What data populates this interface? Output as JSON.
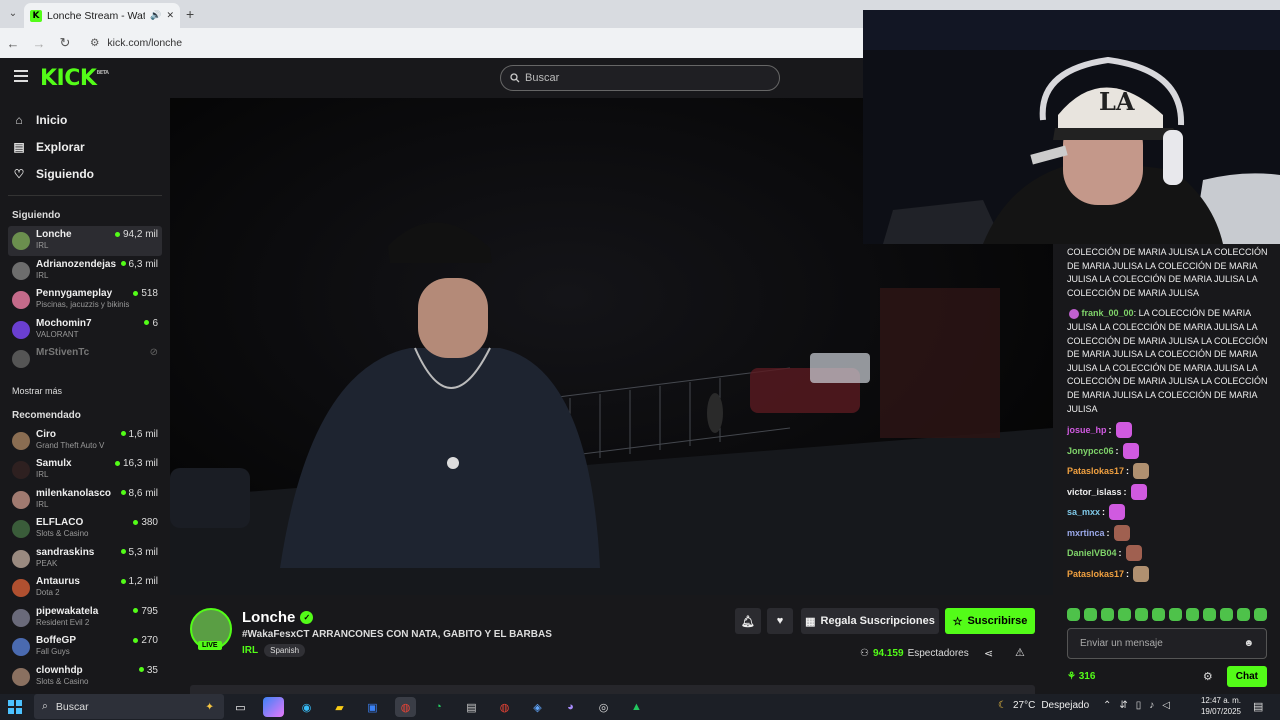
{
  "browser": {
    "tab_title": "Lonche Stream - Watch Live",
    "url": "kick.com/lonche"
  },
  "header": {
    "logo": "KICK",
    "logo_badge": "BETA",
    "search_placeholder": "Buscar"
  },
  "sidebar": {
    "nav": [
      {
        "label": "Inicio",
        "icon": "home-icon"
      },
      {
        "label": "Explorar",
        "icon": "compass-icon"
      },
      {
        "label": "Siguiendo",
        "icon": "heart-icon"
      }
    ],
    "following_title": "Siguiendo",
    "following": [
      {
        "name": "Lonche",
        "category": "IRL",
        "viewers": "94,2 mil",
        "color": "#6b8f4e"
      },
      {
        "name": "Adrianozendejas",
        "category": "IRL",
        "viewers": "6,3 mil",
        "color": "#6d6d6d"
      },
      {
        "name": "Pennygameplay",
        "category": "Piscinas, jacuzzis y bikinis",
        "viewers": "518",
        "color": "#c46a8a"
      },
      {
        "name": "Mochomin7",
        "category": "VALORANT",
        "viewers": "6",
        "color": "#6a3fd0"
      },
      {
        "name": "MrStivenTc",
        "category": "",
        "viewers": "",
        "color": "#555"
      }
    ],
    "show_more": "Mostrar más",
    "recommended_title": "Recomendado",
    "recommended": [
      {
        "name": "Ciro",
        "category": "Grand Theft Auto V",
        "viewers": "1,6 mil",
        "color": "#8a6d52"
      },
      {
        "name": "Samulx",
        "category": "IRL",
        "viewers": "16,3 mil",
        "color": "#2e2020"
      },
      {
        "name": "milenkanolasco",
        "category": "IRL",
        "viewers": "8,6 mil",
        "color": "#a07a70"
      },
      {
        "name": "ELFLACO",
        "category": "Slots & Casino",
        "viewers": "380",
        "color": "#3a5c3a"
      },
      {
        "name": "sandraskins",
        "category": "PEAK",
        "viewers": "5,3 mil",
        "color": "#9a8a80"
      },
      {
        "name": "Antaurus",
        "category": "Dota 2",
        "viewers": "1,2 mil",
        "color": "#b05030"
      },
      {
        "name": "pipewakatela",
        "category": "Resident Evil 2",
        "viewers": "795",
        "color": "#6a6a7a"
      },
      {
        "name": "BoffeGP",
        "category": "Fall Guys",
        "viewers": "270",
        "color": "#4a6ab0"
      },
      {
        "name": "clownhdp",
        "category": "Slots & Casino",
        "viewers": "35",
        "color": "#8a7060"
      }
    ]
  },
  "stream": {
    "name": "Lonche",
    "live_badge": "LIVE",
    "title": "#WakaFesxCT ARRANCONES CON NATA, GABITO Y EL BARBAS",
    "category": "IRL",
    "tag": "Spanish",
    "gift_label": "Regala Suscripciones",
    "subscribe_label": "Suscribirse",
    "viewers_count": "94.159",
    "viewers_label": "Espectadores"
  },
  "chat": {
    "top_message": "COLECCIÓN DE MARIA JULISA LA COLECCIÓN DE MARIA JULISA LA COLECCIÓN DE MARIA JULISA LA COLECCIÓN DE MARIA JULISA LA COLECCIÓN DE MARIA JULISA",
    "messages": [
      {
        "user": "frank_00_00",
        "text": "LA COLECCIÓN DE MARIA JULISA LA COLECCIÓN DE MARIA JULISA LA COLECCIÓN DE MARIA JULISA LA COLECCIÓN DE MARIA JULISA LA COLECCIÓN DE MARIA JULISA LA COLECCIÓN DE MARIA JULISA LA COLECCIÓN DE MARIA JULISA LA COLECCIÓN DE MARIA JULISA LA COLECCIÓN DE MARIA JULISA",
        "color": "#7fd36a"
      }
    ],
    "emote_messages": [
      {
        "user": "josue_hp",
        "color": "#d05ae0",
        "emote_color": "#d05ae0"
      },
      {
        "user": "Jonypcc06",
        "color": "#7fd36a",
        "emote_color": "#d05ae0"
      },
      {
        "user": "Pataslokas17",
        "color": "#f0a040",
        "emote_color": "#b09070"
      },
      {
        "user": "victor_islass",
        "color": "#eeeeee",
        "emote_color": "#d05ae0"
      },
      {
        "user": "sa_mxx",
        "color": "#7fc8e8",
        "emote_color": "#d05ae0"
      },
      {
        "user": "mxrtinca",
        "color": "#9aa8e8",
        "emote_color": "#a06050"
      },
      {
        "user": "DanielVB04",
        "color": "#7fd36a",
        "emote_color": "#a06050"
      },
      {
        "user": "Pataslokas17",
        "color": "#f0a040",
        "emote_color": "#b09070"
      }
    ],
    "input_placeholder": "Enviar un mensaje",
    "points": "316",
    "send_label": "Chat"
  },
  "taskbar": {
    "search_placeholder": "Buscar",
    "temperature": "27°C",
    "weather": "Despejado",
    "time": "12:47 a. m.",
    "date": "19/07/2025"
  }
}
